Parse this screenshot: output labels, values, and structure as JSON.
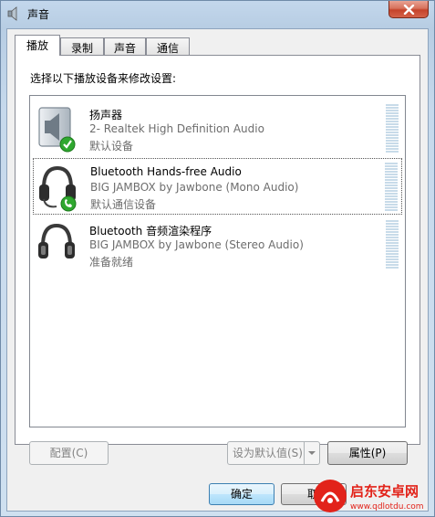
{
  "window": {
    "title": "声音"
  },
  "tabs": [
    {
      "label": "播放",
      "active": true
    },
    {
      "label": "录制",
      "active": false
    },
    {
      "label": "声音",
      "active": false
    },
    {
      "label": "通信",
      "active": false
    }
  ],
  "instruction": "选择以下播放设备来修改设置:",
  "devices": [
    {
      "name": "扬声器",
      "description": "2- Realtek High Definition Audio",
      "status": "默认设备",
      "icon": "speaker-icon",
      "badge": "default-check-badge-icon",
      "selected": false
    },
    {
      "name": "Bluetooth Hands-free Audio",
      "description": "BIG JAMBOX by Jawbone (Mono Audio)",
      "status": "默认通信设备",
      "icon": "headset-icon",
      "badge": "default-communication-phone-badge-icon",
      "selected": true
    },
    {
      "name": "Bluetooth 音频渲染程序",
      "description": "BIG JAMBOX by Jawbone (Stereo Audio)",
      "status": "准备就绪",
      "icon": "headphones-icon",
      "badge": "",
      "selected": false
    }
  ],
  "buttons": {
    "configure": "配置(C)",
    "set_default": "设为默认值(S)",
    "properties": "属性(P)",
    "ok": "确定",
    "cancel": "取"
  },
  "watermark": {
    "brand": "启东安卓网",
    "url": "www.qdlotdu.com"
  },
  "colors": {
    "accent_green": "#2fa82f",
    "meter_bar": "#c8dbe9",
    "close_red": "#c5432b",
    "watermark_red": "#e2231a"
  }
}
